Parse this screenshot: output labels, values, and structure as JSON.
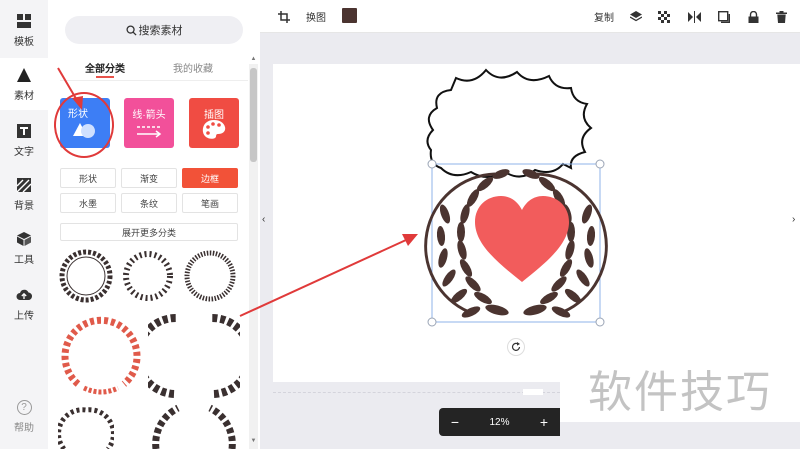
{
  "rail": {
    "items": [
      {
        "label": "模板",
        "icon": "template-icon"
      },
      {
        "label": "素材",
        "icon": "material-icon"
      },
      {
        "label": "文字",
        "icon": "text-icon"
      },
      {
        "label": "背景",
        "icon": "background-icon"
      },
      {
        "label": "工具",
        "icon": "tools-icon"
      },
      {
        "label": "上传",
        "icon": "upload-icon"
      }
    ],
    "help_label": "帮助",
    "help_glyph": "?"
  },
  "panel": {
    "search_label": "搜索素材",
    "tabs": [
      "全部分类",
      "我的收藏"
    ],
    "categories": [
      {
        "label": "形状",
        "color": "#3d7ef5"
      },
      {
        "label": "线·箭头",
        "color": "#f2509a"
      },
      {
        "label": "插图",
        "color": "#f04c43"
      }
    ],
    "chips": [
      "形状",
      "渐变",
      "边框",
      "水墨",
      "条纹",
      "笔画"
    ],
    "active_chip": "边框",
    "expand_label": "展开更多分类"
  },
  "toolbar": {
    "swap_label": "换图",
    "copy_label": "复制",
    "color": "#4b3430"
  },
  "canvas": {
    "heart_color": "#f25c5c",
    "wreath_color": "#4b3430"
  },
  "zoom": {
    "minus": "−",
    "value": "12%",
    "plus": "+"
  },
  "watermark": "软件技巧"
}
